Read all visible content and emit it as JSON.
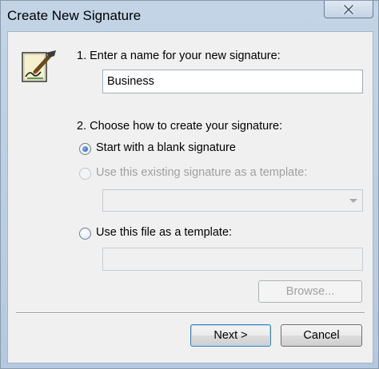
{
  "window": {
    "title": "Create New Signature"
  },
  "step1": {
    "label": "1. Enter a name for your new signature:",
    "name_value": "Business"
  },
  "step2": {
    "label": "2. Choose how to create your signature:",
    "options": [
      {
        "label": "Start with a blank signature",
        "selected": true,
        "enabled": true
      },
      {
        "label": "Use this existing signature as a template:",
        "selected": false,
        "enabled": false
      },
      {
        "label": "Use this file as a template:",
        "selected": false,
        "enabled": true
      }
    ],
    "existing_signature_value": "",
    "file_path_value": ""
  },
  "buttons": {
    "browse": "Browse...",
    "next": "Next >",
    "cancel": "Cancel"
  },
  "icons": {
    "close": "close-icon",
    "signature": "signature-pen-icon",
    "dropdown": "chevron-down-icon"
  }
}
